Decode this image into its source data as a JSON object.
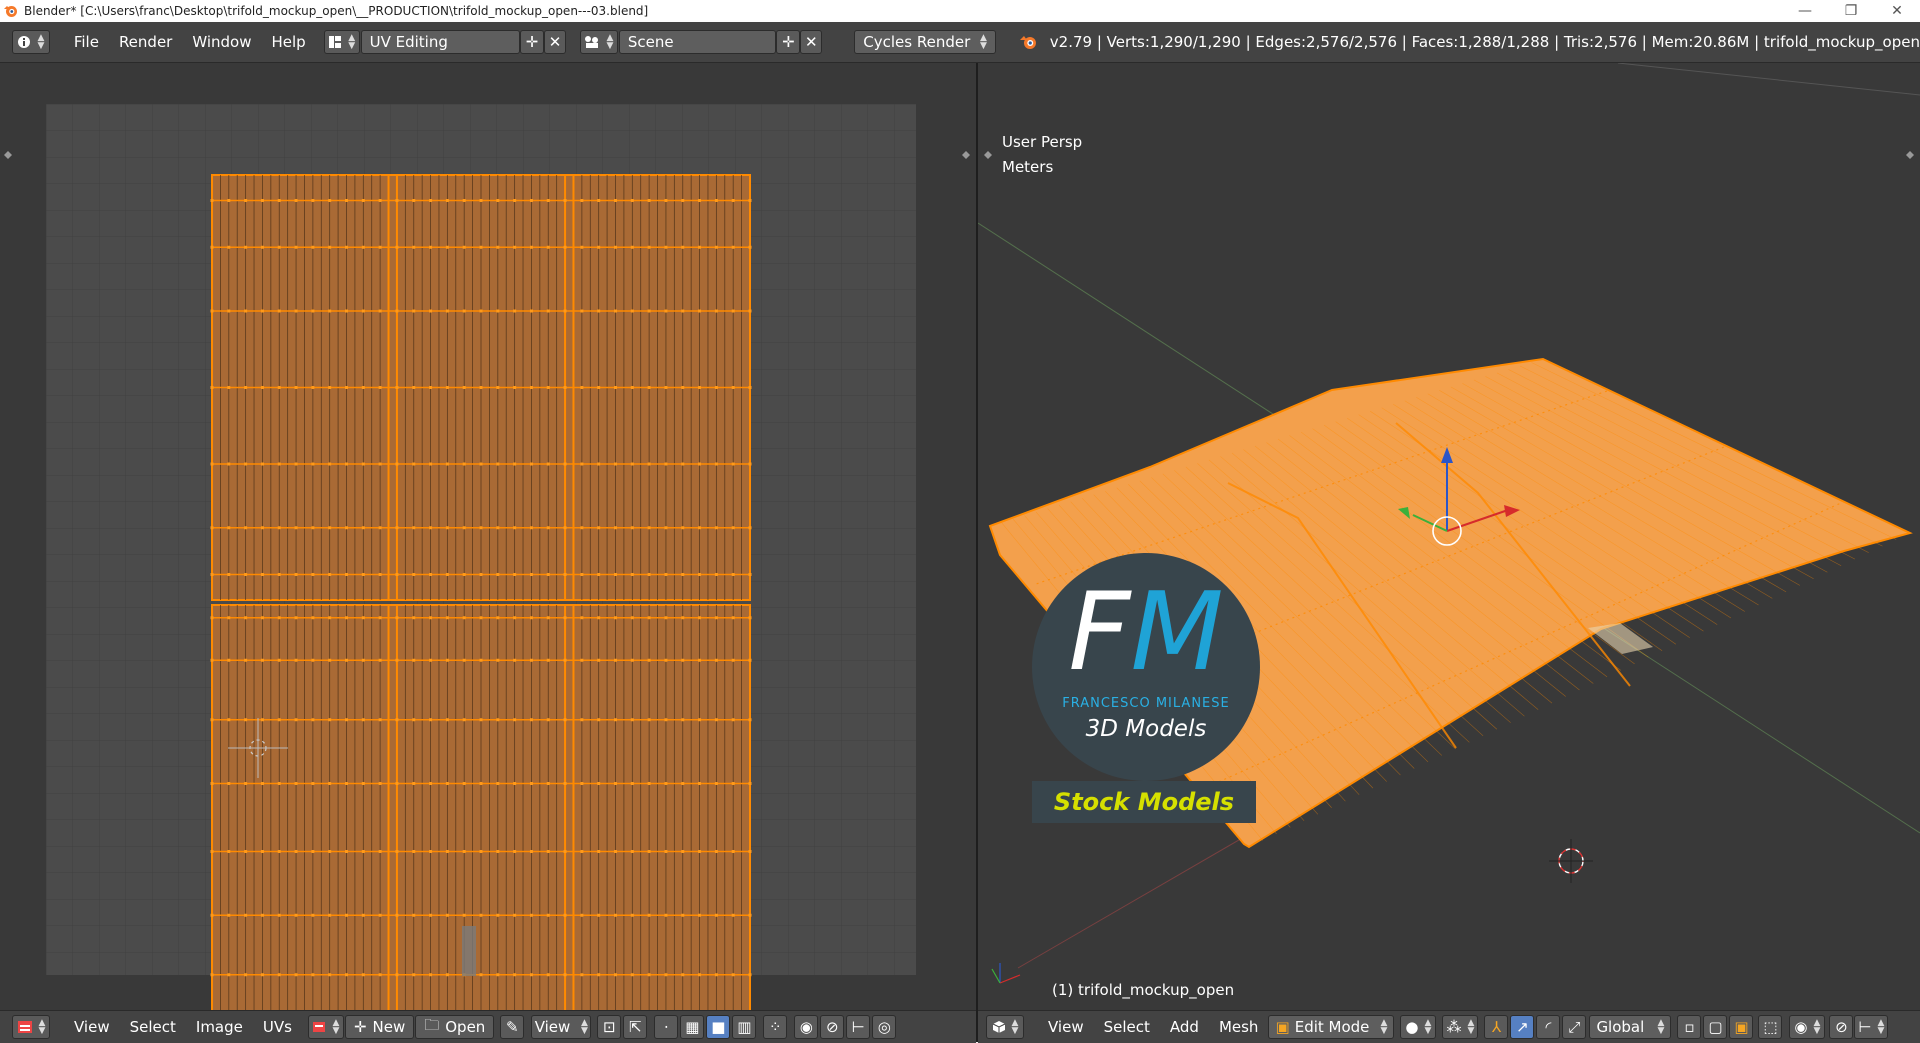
{
  "window": {
    "title": "Blender* [C:\\Users\\franc\\Desktop\\trifold_mockup_open\\__PRODUCTION\\trifold_mockup_open---03.blend]",
    "minimize_glyph": "—",
    "maximize_glyph": "❐",
    "close_glyph": "✕"
  },
  "info_header": {
    "menus": [
      "File",
      "Render",
      "Window",
      "Help"
    ],
    "screen_layout": "UV Editing",
    "scene": "Scene",
    "render_engine": "Cycles Render",
    "stats": "v2.79 | Verts:1,290/1,290 | Edges:2,576/2,576 | Faces:1,288/1,288 | Tris:2,576 | Mem:20.86M | trifold_mockup_open"
  },
  "uv_editor": {
    "footer_menus": [
      "View",
      "Select",
      "Image",
      "UVs"
    ],
    "new_label": "New",
    "open_label": "Open",
    "view_label": "View"
  },
  "viewport": {
    "view_name": "User Persp",
    "units": "Meters",
    "object_label": "(1) trifold_mockup_open",
    "footer_menus": [
      "View",
      "Select",
      "Add",
      "Mesh"
    ],
    "mode": "Edit Mode",
    "orientation": "Global"
  },
  "logo": {
    "letter_f": "F",
    "letter_m": "M",
    "company": "FRANCESCO MILANESE",
    "tagline": "3D Models",
    "banner": "Stock Models"
  },
  "colors": {
    "mesh_orange": "#f3a04c",
    "edge_orange": "#ff8a00",
    "header_bg": "#434343",
    "editor_bg": "#393939"
  },
  "icons": {
    "info": "info-icon",
    "blender": "blender-logo-icon",
    "cursor": "3d-cursor-icon"
  }
}
